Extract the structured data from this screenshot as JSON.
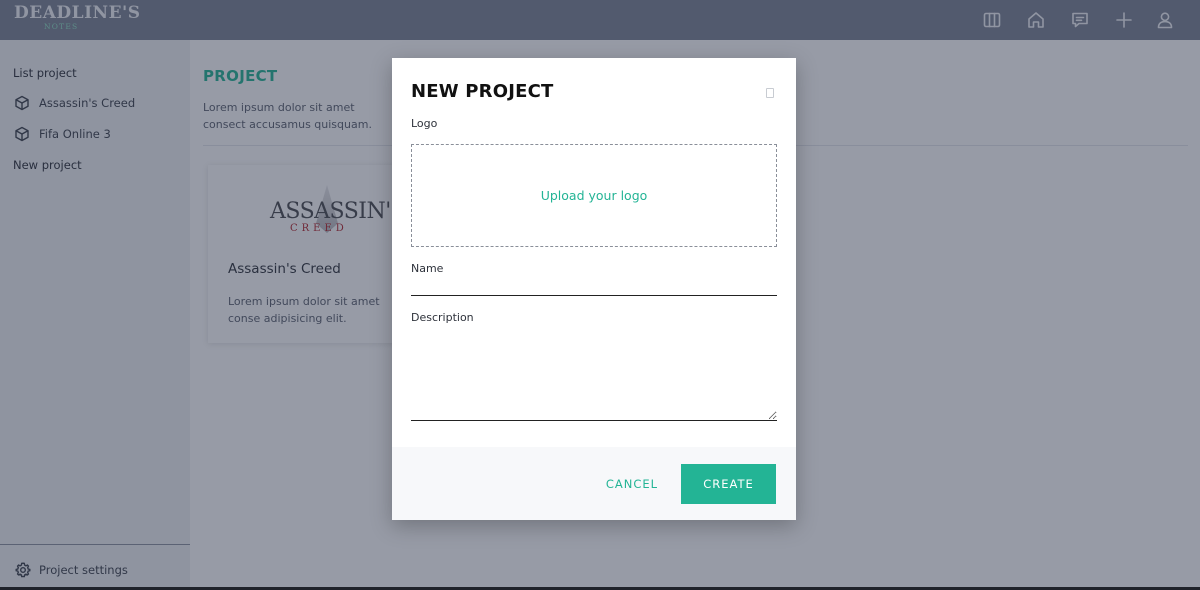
{
  "app": {
    "logo_main": "DEADLINE'S",
    "logo_sub": "NOTES"
  },
  "topnav": {
    "icons": [
      "columns-icon",
      "home-icon",
      "message-icon",
      "plus-icon",
      "user-icon"
    ]
  },
  "sidebar": {
    "heading": "List project",
    "projects": [
      {
        "label": "Assassin's Creed",
        "icon": "cube-icon"
      },
      {
        "label": "Fifa Online 3",
        "icon": "cube-icon"
      }
    ],
    "new_project_label": "New project",
    "settings_label": "Project settings"
  },
  "main": {
    "title": "PROJECT",
    "description": "Lorem ipsum dolor sit amet consect accusamus quisquam.",
    "cards": [
      {
        "logo_word": "ASSASSIN'S",
        "logo_subword": "CREED",
        "title": "Assassin's Creed",
        "description": "Lorem ipsum dolor sit amet conse adipisicing elit."
      }
    ]
  },
  "modal": {
    "title": "NEW PROJECT",
    "logo_label": "Logo",
    "upload_text": "Upload your logo",
    "name_label": "Name",
    "name_value": "",
    "description_label": "Description",
    "description_value": "",
    "cancel_label": "CANCEL",
    "create_label": "CREATE"
  },
  "colors": {
    "accent": "#23b495",
    "topbar": "#7b8294",
    "overlay": "rgba(38,46,68,0.48)"
  }
}
